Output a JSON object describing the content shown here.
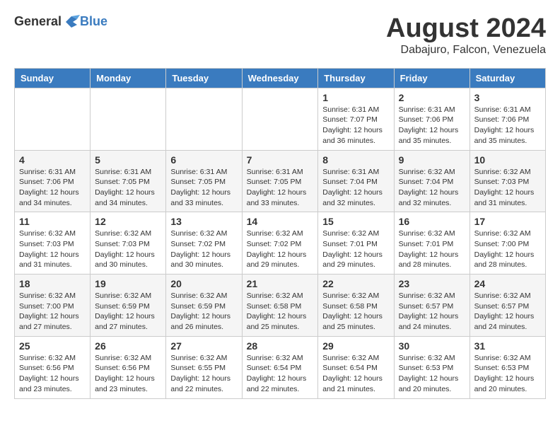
{
  "header": {
    "logo_general": "General",
    "logo_blue": "Blue",
    "month_title": "August 2024",
    "location": "Dabajuro, Falcon, Venezuela"
  },
  "calendar": {
    "days_of_week": [
      "Sunday",
      "Monday",
      "Tuesday",
      "Wednesday",
      "Thursday",
      "Friday",
      "Saturday"
    ],
    "weeks": [
      [
        {
          "day": "",
          "info": ""
        },
        {
          "day": "",
          "info": ""
        },
        {
          "day": "",
          "info": ""
        },
        {
          "day": "",
          "info": ""
        },
        {
          "day": "1",
          "info": "Sunrise: 6:31 AM\nSunset: 7:07 PM\nDaylight: 12 hours\nand 36 minutes."
        },
        {
          "day": "2",
          "info": "Sunrise: 6:31 AM\nSunset: 7:06 PM\nDaylight: 12 hours\nand 35 minutes."
        },
        {
          "day": "3",
          "info": "Sunrise: 6:31 AM\nSunset: 7:06 PM\nDaylight: 12 hours\nand 35 minutes."
        }
      ],
      [
        {
          "day": "4",
          "info": "Sunrise: 6:31 AM\nSunset: 7:06 PM\nDaylight: 12 hours\nand 34 minutes."
        },
        {
          "day": "5",
          "info": "Sunrise: 6:31 AM\nSunset: 7:05 PM\nDaylight: 12 hours\nand 34 minutes."
        },
        {
          "day": "6",
          "info": "Sunrise: 6:31 AM\nSunset: 7:05 PM\nDaylight: 12 hours\nand 33 minutes."
        },
        {
          "day": "7",
          "info": "Sunrise: 6:31 AM\nSunset: 7:05 PM\nDaylight: 12 hours\nand 33 minutes."
        },
        {
          "day": "8",
          "info": "Sunrise: 6:31 AM\nSunset: 7:04 PM\nDaylight: 12 hours\nand 32 minutes."
        },
        {
          "day": "9",
          "info": "Sunrise: 6:32 AM\nSunset: 7:04 PM\nDaylight: 12 hours\nand 32 minutes."
        },
        {
          "day": "10",
          "info": "Sunrise: 6:32 AM\nSunset: 7:03 PM\nDaylight: 12 hours\nand 31 minutes."
        }
      ],
      [
        {
          "day": "11",
          "info": "Sunrise: 6:32 AM\nSunset: 7:03 PM\nDaylight: 12 hours\nand 31 minutes."
        },
        {
          "day": "12",
          "info": "Sunrise: 6:32 AM\nSunset: 7:03 PM\nDaylight: 12 hours\nand 30 minutes."
        },
        {
          "day": "13",
          "info": "Sunrise: 6:32 AM\nSunset: 7:02 PM\nDaylight: 12 hours\nand 30 minutes."
        },
        {
          "day": "14",
          "info": "Sunrise: 6:32 AM\nSunset: 7:02 PM\nDaylight: 12 hours\nand 29 minutes."
        },
        {
          "day": "15",
          "info": "Sunrise: 6:32 AM\nSunset: 7:01 PM\nDaylight: 12 hours\nand 29 minutes."
        },
        {
          "day": "16",
          "info": "Sunrise: 6:32 AM\nSunset: 7:01 PM\nDaylight: 12 hours\nand 28 minutes."
        },
        {
          "day": "17",
          "info": "Sunrise: 6:32 AM\nSunset: 7:00 PM\nDaylight: 12 hours\nand 28 minutes."
        }
      ],
      [
        {
          "day": "18",
          "info": "Sunrise: 6:32 AM\nSunset: 7:00 PM\nDaylight: 12 hours\nand 27 minutes."
        },
        {
          "day": "19",
          "info": "Sunrise: 6:32 AM\nSunset: 6:59 PM\nDaylight: 12 hours\nand 27 minutes."
        },
        {
          "day": "20",
          "info": "Sunrise: 6:32 AM\nSunset: 6:59 PM\nDaylight: 12 hours\nand 26 minutes."
        },
        {
          "day": "21",
          "info": "Sunrise: 6:32 AM\nSunset: 6:58 PM\nDaylight: 12 hours\nand 25 minutes."
        },
        {
          "day": "22",
          "info": "Sunrise: 6:32 AM\nSunset: 6:58 PM\nDaylight: 12 hours\nand 25 minutes."
        },
        {
          "day": "23",
          "info": "Sunrise: 6:32 AM\nSunset: 6:57 PM\nDaylight: 12 hours\nand 24 minutes."
        },
        {
          "day": "24",
          "info": "Sunrise: 6:32 AM\nSunset: 6:57 PM\nDaylight: 12 hours\nand 24 minutes."
        }
      ],
      [
        {
          "day": "25",
          "info": "Sunrise: 6:32 AM\nSunset: 6:56 PM\nDaylight: 12 hours\nand 23 minutes."
        },
        {
          "day": "26",
          "info": "Sunrise: 6:32 AM\nSunset: 6:56 PM\nDaylight: 12 hours\nand 23 minutes."
        },
        {
          "day": "27",
          "info": "Sunrise: 6:32 AM\nSunset: 6:55 PM\nDaylight: 12 hours\nand 22 minutes."
        },
        {
          "day": "28",
          "info": "Sunrise: 6:32 AM\nSunset: 6:54 PM\nDaylight: 12 hours\nand 22 minutes."
        },
        {
          "day": "29",
          "info": "Sunrise: 6:32 AM\nSunset: 6:54 PM\nDaylight: 12 hours\nand 21 minutes."
        },
        {
          "day": "30",
          "info": "Sunrise: 6:32 AM\nSunset: 6:53 PM\nDaylight: 12 hours\nand 20 minutes."
        },
        {
          "day": "31",
          "info": "Sunrise: 6:32 AM\nSunset: 6:53 PM\nDaylight: 12 hours\nand 20 minutes."
        }
      ]
    ]
  }
}
